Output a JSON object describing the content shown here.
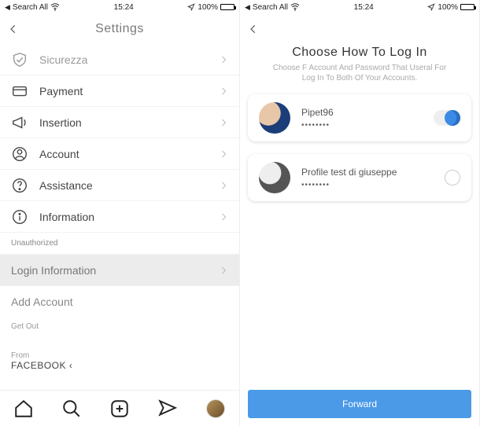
{
  "status_bar": {
    "carrier": "Search All",
    "time": "15:24",
    "battery": "100%"
  },
  "left": {
    "nav_title": "Settings",
    "items": [
      {
        "icon": "shield-icon",
        "label": "Sicurezza"
      },
      {
        "icon": "card-icon",
        "label": "Payment"
      },
      {
        "icon": "megaphone-icon",
        "label": "Insertion"
      },
      {
        "icon": "person-icon",
        "label": "Account"
      },
      {
        "icon": "help-icon",
        "label": "Assistance"
      },
      {
        "icon": "info-icon",
        "label": "Information"
      }
    ],
    "unauthorized_label": "Unauthorized",
    "login_info_label": "Login Information",
    "add_account_label": "Add Account",
    "get_out_label": "Get Out",
    "from_label": "From",
    "facebook_label": "FACEBOOK"
  },
  "right": {
    "title": "Choose How To Log In",
    "subtitle_line1": "Choose F Account And Password That Useral For",
    "subtitle_line2": "Log In To Both Of Your Accounts.",
    "accounts": [
      {
        "name": "Pipet96",
        "password_mask": "••••••••",
        "selected": true
      },
      {
        "name": "Profile test di giuseppe",
        "password_mask": "••••••••",
        "selected": false
      }
    ],
    "forward_label": "Forward"
  }
}
